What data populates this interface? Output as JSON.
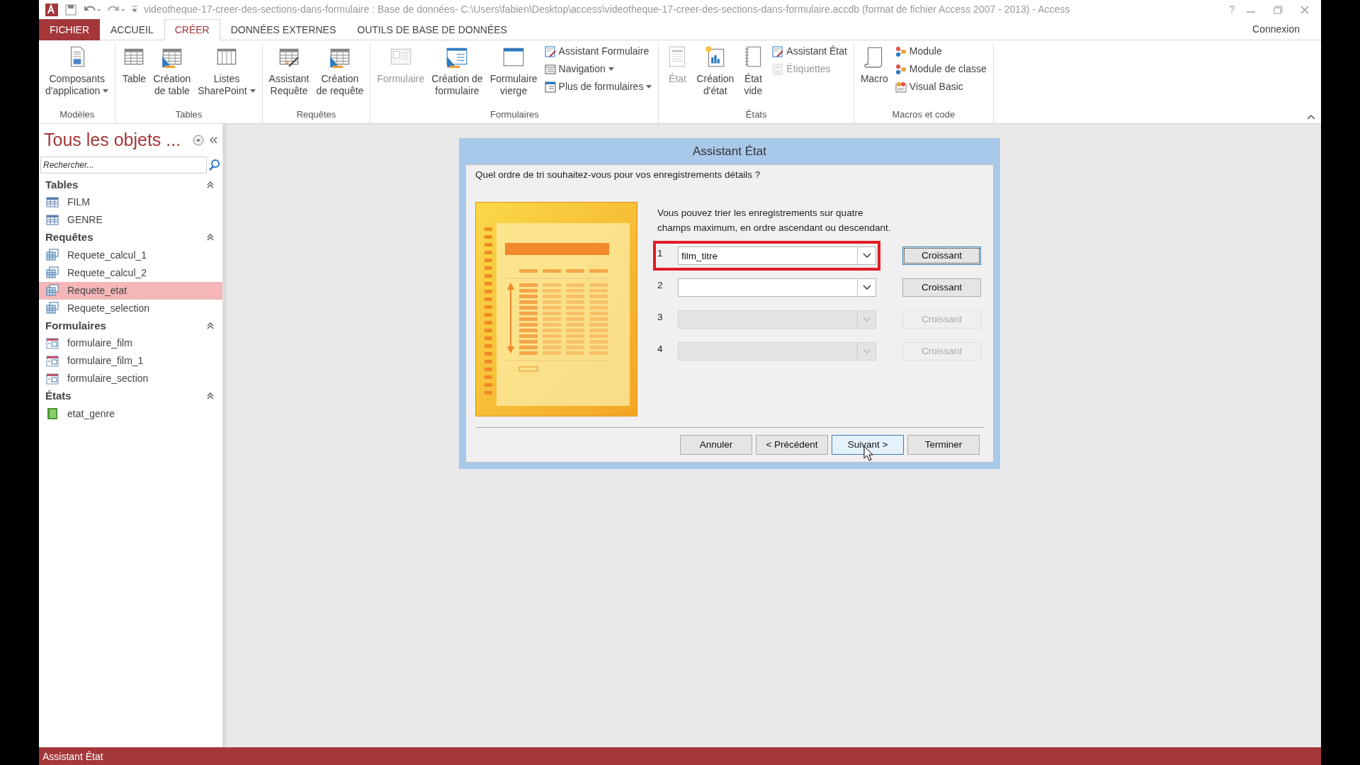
{
  "window": {
    "title": "videotheque-17-creer-des-sections-dans-formulaire : Base de données- C:\\Users\\fabien\\Desktop\\access\\videotheque-17-creer-des-sections-dans-formulaire.accdb (format de fichier Access 2007 - 2013) - Access",
    "help": "?"
  },
  "tabs": [
    {
      "label": "FICHIER",
      "kind": "file",
      "selected": false
    },
    {
      "label": "ACCUEIL",
      "kind": "tab",
      "selected": false
    },
    {
      "label": "CRÉER",
      "kind": "tab",
      "selected": true
    },
    {
      "label": "DONNÉES EXTERNES",
      "kind": "tab",
      "selected": false
    },
    {
      "label": "OUTILS DE BASE DE DONNÉES",
      "kind": "tab",
      "selected": false
    }
  ],
  "account": {
    "label": "Connexion"
  },
  "ribbon": {
    "groups": [
      {
        "label": "Modèles",
        "items": [
          {
            "kind": "large",
            "lines": [
              "Composants",
              "d'application"
            ],
            "dropdown": true,
            "disabled": false
          }
        ]
      },
      {
        "label": "Tables",
        "items": [
          {
            "kind": "large",
            "lines": [
              "Table"
            ],
            "dropdown": false,
            "disabled": false
          },
          {
            "kind": "large",
            "lines": [
              "Création",
              "de table"
            ],
            "dropdown": false,
            "disabled": false
          },
          {
            "kind": "large",
            "lines": [
              "Listes",
              "SharePoint"
            ],
            "dropdown": true,
            "disabled": false
          }
        ]
      },
      {
        "label": "Requêtes",
        "items": [
          {
            "kind": "large",
            "lines": [
              "Assistant",
              "Requête"
            ],
            "dropdown": false,
            "disabled": false
          },
          {
            "kind": "large",
            "lines": [
              "Création",
              "de requête"
            ],
            "dropdown": false,
            "disabled": false
          }
        ]
      },
      {
        "label": "Formulaires",
        "items": [
          {
            "kind": "large",
            "lines": [
              "Formulaire"
            ],
            "dropdown": false,
            "disabled": true
          },
          {
            "kind": "large",
            "lines": [
              "Création de",
              "formulaire"
            ],
            "dropdown": false,
            "disabled": false
          },
          {
            "kind": "large",
            "lines": [
              "Formulaire",
              "vierge"
            ],
            "dropdown": false,
            "disabled": false
          },
          {
            "kind": "small",
            "label": "Assistant Formulaire",
            "dropdown": false,
            "disabled": false
          },
          {
            "kind": "small",
            "label": "Navigation",
            "dropdown": true,
            "disabled": false
          },
          {
            "kind": "small",
            "label": "Plus de formulaires",
            "dropdown": true,
            "disabled": false
          }
        ]
      },
      {
        "label": "États",
        "items": [
          {
            "kind": "large",
            "lines": [
              "État"
            ],
            "dropdown": false,
            "disabled": true
          },
          {
            "kind": "large",
            "lines": [
              "Création",
              "d'état"
            ],
            "dropdown": false,
            "disabled": false
          },
          {
            "kind": "large",
            "lines": [
              "État",
              "vide"
            ],
            "dropdown": false,
            "disabled": false
          },
          {
            "kind": "small",
            "label": "Assistant État",
            "dropdown": false,
            "disabled": false
          },
          {
            "kind": "small",
            "label": "Étiquettes",
            "dropdown": false,
            "disabled": true
          }
        ]
      },
      {
        "label": "Macros et code",
        "items": [
          {
            "kind": "large",
            "lines": [
              "Macro"
            ],
            "dropdown": false,
            "disabled": false
          },
          {
            "kind": "small",
            "label": "Module",
            "dropdown": false,
            "disabled": false
          },
          {
            "kind": "small",
            "label": "Module de classe",
            "dropdown": false,
            "disabled": false
          },
          {
            "kind": "small",
            "label": "Visual Basic",
            "dropdown": false,
            "disabled": false
          }
        ]
      }
    ]
  },
  "sidebar": {
    "title": "Tous les objets ...",
    "search": {
      "placeholder": "Rechercher..."
    },
    "groups": [
      {
        "label": "Tables",
        "expanded": true,
        "items": [
          {
            "kind": "table",
            "label": "FILM",
            "selected": false
          },
          {
            "kind": "table",
            "label": "GENRE",
            "selected": false
          }
        ]
      },
      {
        "label": "Requêtes",
        "expanded": true,
        "items": [
          {
            "kind": "query",
            "label": "Requete_calcul_1",
            "selected": false
          },
          {
            "kind": "query",
            "label": "Requete_calcul_2",
            "selected": false
          },
          {
            "kind": "query",
            "label": "Requete_etat",
            "selected": true
          },
          {
            "kind": "query",
            "label": "Requete_selection",
            "selected": false
          }
        ]
      },
      {
        "label": "Formulaires",
        "expanded": true,
        "items": [
          {
            "kind": "form",
            "label": "formulaire_film",
            "selected": false
          },
          {
            "kind": "form",
            "label": "formulaire_film_1",
            "selected": false
          },
          {
            "kind": "form",
            "label": "formulaire_section",
            "selected": false
          }
        ]
      },
      {
        "label": "États",
        "expanded": true,
        "items": [
          {
            "kind": "report",
            "label": "etat_genre",
            "selected": false
          }
        ]
      }
    ]
  },
  "dialog": {
    "title": "Assistant État",
    "question": "Quel ordre de tri souhaitez-vous pour vos enregistrements détails ?",
    "description": "Vous pouvez trier les enregistrements sur quatre champs maximum, en ordre ascendant ou descendant.",
    "sort_rows": [
      {
        "number": "1",
        "value": "film_titre",
        "order": "Croissant",
        "disabled": false,
        "highlighted": true,
        "focused": true
      },
      {
        "number": "2",
        "order": "Croissant",
        "disabled": false,
        "highlighted": false,
        "focused": false
      },
      {
        "number": "3",
        "order": "Croissant",
        "disabled": true,
        "highlighted": false,
        "focused": false
      },
      {
        "number": "4",
        "order": "Croissant",
        "disabled": true,
        "highlighted": false,
        "focused": false
      }
    ],
    "buttons": [
      {
        "label": "Annuler",
        "hovered": false
      },
      {
        "label": "< Précédent",
        "hovered": false
      },
      {
        "label": "Suivant >",
        "hovered": true
      },
      {
        "label": "Terminer",
        "hovered": false
      }
    ]
  },
  "status_bar": {
    "text": "Assistant État"
  }
}
